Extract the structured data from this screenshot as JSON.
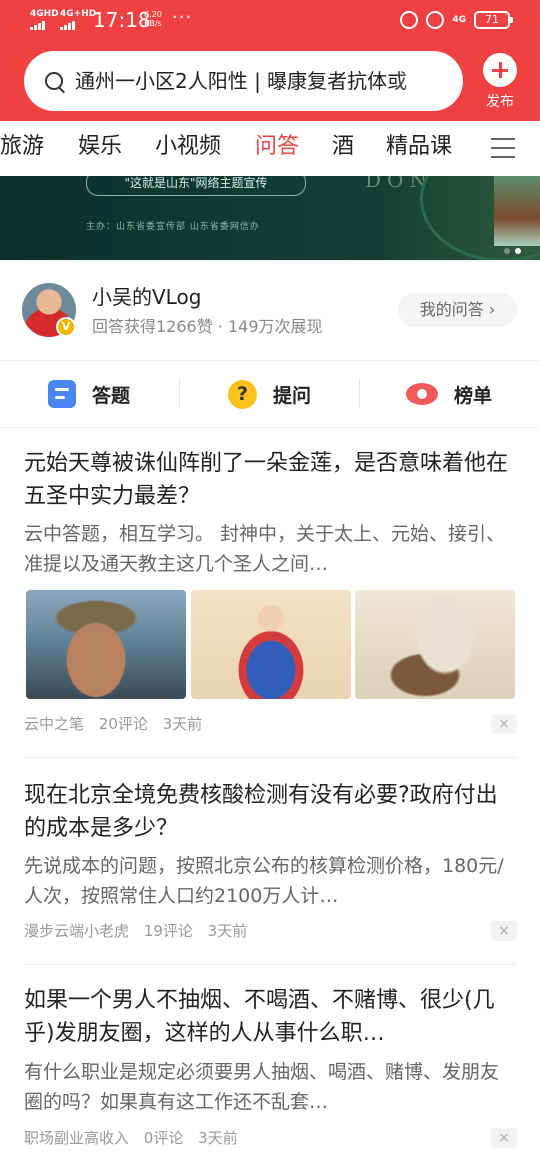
{
  "status_bar": {
    "sim1": "4GHD",
    "sim2": "4G+HD",
    "time": "17:18",
    "speed_value": "6.20",
    "speed_unit": "KB/s",
    "more": "···",
    "network": "4G",
    "battery": "71"
  },
  "search": {
    "query": "通州一小区2人阳性 | 曝康复者抗体或"
  },
  "publish": {
    "label": "发布"
  },
  "tabs": [
    {
      "label": "旅游"
    },
    {
      "label": "娱乐"
    },
    {
      "label": "小视频"
    },
    {
      "label": "问答",
      "active": true
    },
    {
      "label": "酒"
    },
    {
      "label": "精品课"
    }
  ],
  "banner": {
    "pill_text": "\"这就是山东\"网络主题宣传",
    "sub_text": "主办：山东省委宣传部  山东省委网信办",
    "word": "DON",
    "dot_active_color": "#ffffff",
    "dot_inactive_color": "#7f8f8a"
  },
  "profile": {
    "name": "小吴的VLog",
    "badge": "V",
    "stats": "回答获得1266赞 · 149万次展现",
    "my_answers": "我的问答 ›"
  },
  "actions": {
    "answer": "答题",
    "ask": "提问",
    "ask_icon_glyph": "?",
    "rank": "榜单"
  },
  "feed": [
    {
      "title": "元始天尊被诛仙阵削了一朵金莲，是否意味着他在五圣中实力最差？",
      "snippet": "云中答题，相互学习。 封神中，关于太上、元始、接引、准提以及通天教主这几个圣人之间…",
      "author": "云中之笔",
      "comments": "20评论",
      "time": "3天前",
      "has_images": true
    },
    {
      "title": "现在北京全境免费核酸检测有没有必要?政府付出的成本是多少？",
      "snippet": "先说成本的问题，按照北京公布的核算检测价格，180元/人次，按照常住人口约2100万人计…",
      "author": "漫步云端小老虎",
      "comments": "19评论",
      "time": "3天前",
      "has_images": false
    },
    {
      "title": "如果一个男人不抽烟、不喝酒、不赌博、很少(几乎)发朋友圈，这样的人从事什么职…",
      "snippet": "有什么职业是规定必须要男人抽烟、喝酒、赌博、发朋友圈的吗？如果真有这工作还不乱套…",
      "author": "职场副业高收入",
      "comments": "0评论",
      "time": "3天前",
      "has_images": false
    }
  ],
  "close_glyph": "×",
  "colors": {
    "brand_red": "#f04142",
    "answer_blue": "#4a86f0",
    "ask_yellow": "#fcc21b",
    "rank_red": "#f05a5a"
  }
}
